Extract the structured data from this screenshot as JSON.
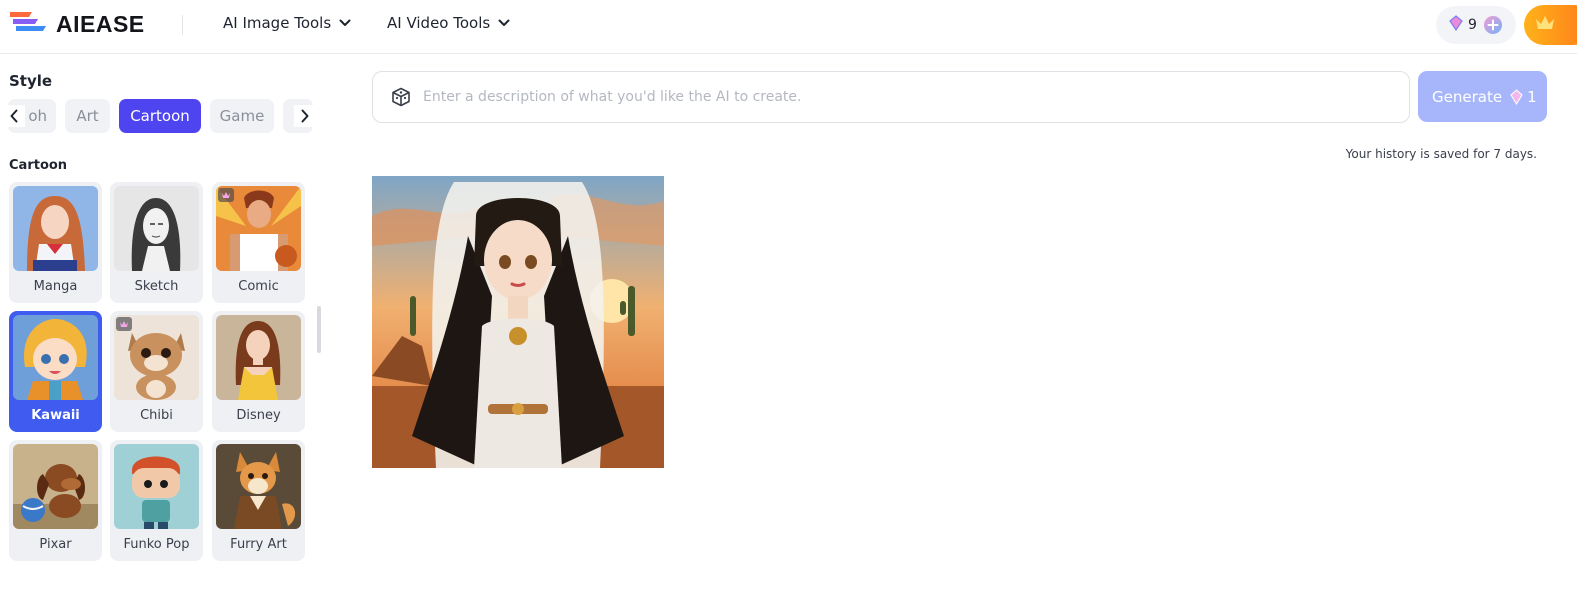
{
  "header": {
    "brand": "AIEASE",
    "nav": [
      {
        "label": "AI Image Tools"
      },
      {
        "label": "AI Video Tools"
      }
    ],
    "credits": "9"
  },
  "sidebar": {
    "style_title": "Style",
    "tabs": [
      {
        "label": "oh",
        "active": false
      },
      {
        "label": "Art",
        "active": false
      },
      {
        "label": "Cartoon",
        "active": true
      },
      {
        "label": "Game",
        "active": false
      }
    ],
    "category_title": "Cartoon",
    "styles": [
      {
        "label": "Manga",
        "selected": false,
        "premium": false
      },
      {
        "label": "Sketch",
        "selected": false,
        "premium": false
      },
      {
        "label": "Comic",
        "selected": false,
        "premium": true
      },
      {
        "label": "Kawaii",
        "selected": true,
        "premium": false
      },
      {
        "label": "Chibi",
        "selected": false,
        "premium": true
      },
      {
        "label": "Disney",
        "selected": false,
        "premium": false
      },
      {
        "label": "Pixar",
        "selected": false,
        "premium": false
      },
      {
        "label": "Funko Pop",
        "selected": false,
        "premium": false
      },
      {
        "label": "Furry Art",
        "selected": false,
        "premium": false
      }
    ]
  },
  "main": {
    "prompt_placeholder": "Enter a description of what you'd like the AI to create.",
    "prompt_value": "",
    "generate_label": "Generate",
    "generate_cost": "1",
    "history_note": "Your history is saved for 7 days."
  },
  "colors": {
    "accent": "#4f45f0",
    "selected_card": "#3f5bf0",
    "generate_button": "#a7b6fb",
    "upgrade_start": "#ffb21a",
    "upgrade_end": "#ff7a1a"
  }
}
